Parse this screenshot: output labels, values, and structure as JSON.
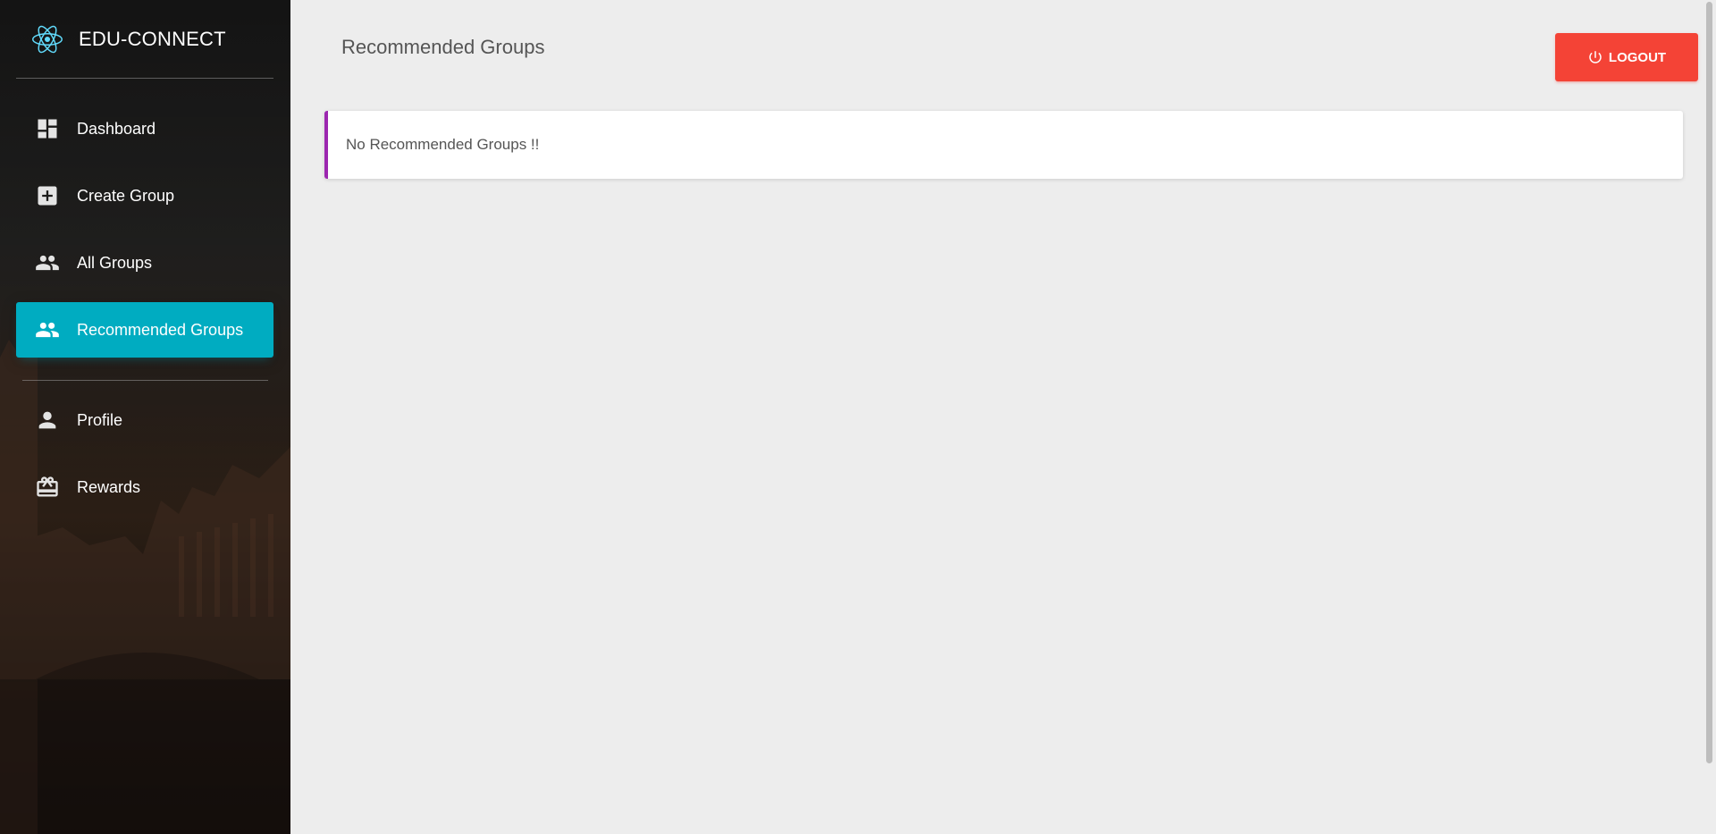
{
  "brand": {
    "name": "EDU-CONNECT",
    "logo_icon": "react-atom-icon",
    "logo_color": "#61dafb"
  },
  "sidebar": {
    "items": [
      {
        "label": "Dashboard",
        "icon": "dashboard-icon",
        "active": false
      },
      {
        "label": "Create Group",
        "icon": "add-box-icon",
        "active": false
      },
      {
        "label": "All Groups",
        "icon": "people-icon",
        "active": false
      },
      {
        "label": "Recommended Groups",
        "icon": "people-icon",
        "active": true
      },
      {
        "label": "Profile",
        "icon": "person-icon",
        "active": false
      },
      {
        "label": "Rewards",
        "icon": "card-giftcard-icon",
        "active": false
      }
    ],
    "active_color": "#00acc1"
  },
  "header": {
    "title": "Recommended Groups",
    "logout_label": "LOGOUT",
    "logout_icon": "power-icon",
    "logout_color": "#f44336"
  },
  "content": {
    "empty_message": "No Recommended Groups !!",
    "accent_color": "#9c27b0"
  }
}
